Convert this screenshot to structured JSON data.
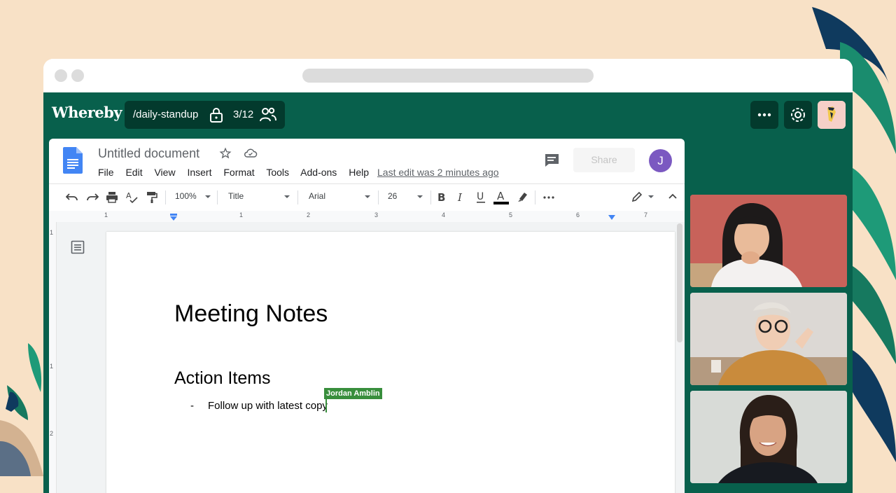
{
  "app": {
    "brand": "Whereby",
    "room_name": "/daily-standup",
    "participant_count": "3/12"
  },
  "doc": {
    "title": "Untitled document",
    "menu": [
      "File",
      "Edit",
      "View",
      "Insert",
      "Format",
      "Tools",
      "Add-ons",
      "Help"
    ],
    "last_edit": "Last edit was 2 minutes ago",
    "share_label": "Share",
    "user_initial": "J",
    "toolbar": {
      "zoom": "100%",
      "style": "Title",
      "font": "Arial",
      "size": "26"
    },
    "ruler_numbers": [
      "1",
      "1",
      "2",
      "3",
      "4",
      "5",
      "6",
      "7"
    ],
    "vruler_numbers": [
      "1",
      "1",
      "2"
    ],
    "content": {
      "heading": "Meeting Notes",
      "subheading": "Action Items",
      "bullet_marker": "-",
      "bullet_text": "Follow up with latest copy",
      "collaborator": "Jordan Amblin"
    }
  },
  "colors": {
    "room_green": "#08604c",
    "pill_dark": "#033a2d",
    "cursor_green": "#388e3c",
    "doc_blue": "#4285f4",
    "avatar_purple": "#7b59c1",
    "page_background": "#f8e1c6"
  },
  "icons": [
    "lock-icon",
    "people-icon",
    "more-icon",
    "gear-icon",
    "star-icon",
    "cloud-icon",
    "comment-icon",
    "undo-icon",
    "redo-icon",
    "print-icon",
    "spellcheck-icon",
    "paint-format-icon",
    "bold-icon",
    "italic-icon",
    "underline-icon",
    "text-color-icon",
    "highlight-icon",
    "pencil-icon",
    "outline-icon"
  ]
}
